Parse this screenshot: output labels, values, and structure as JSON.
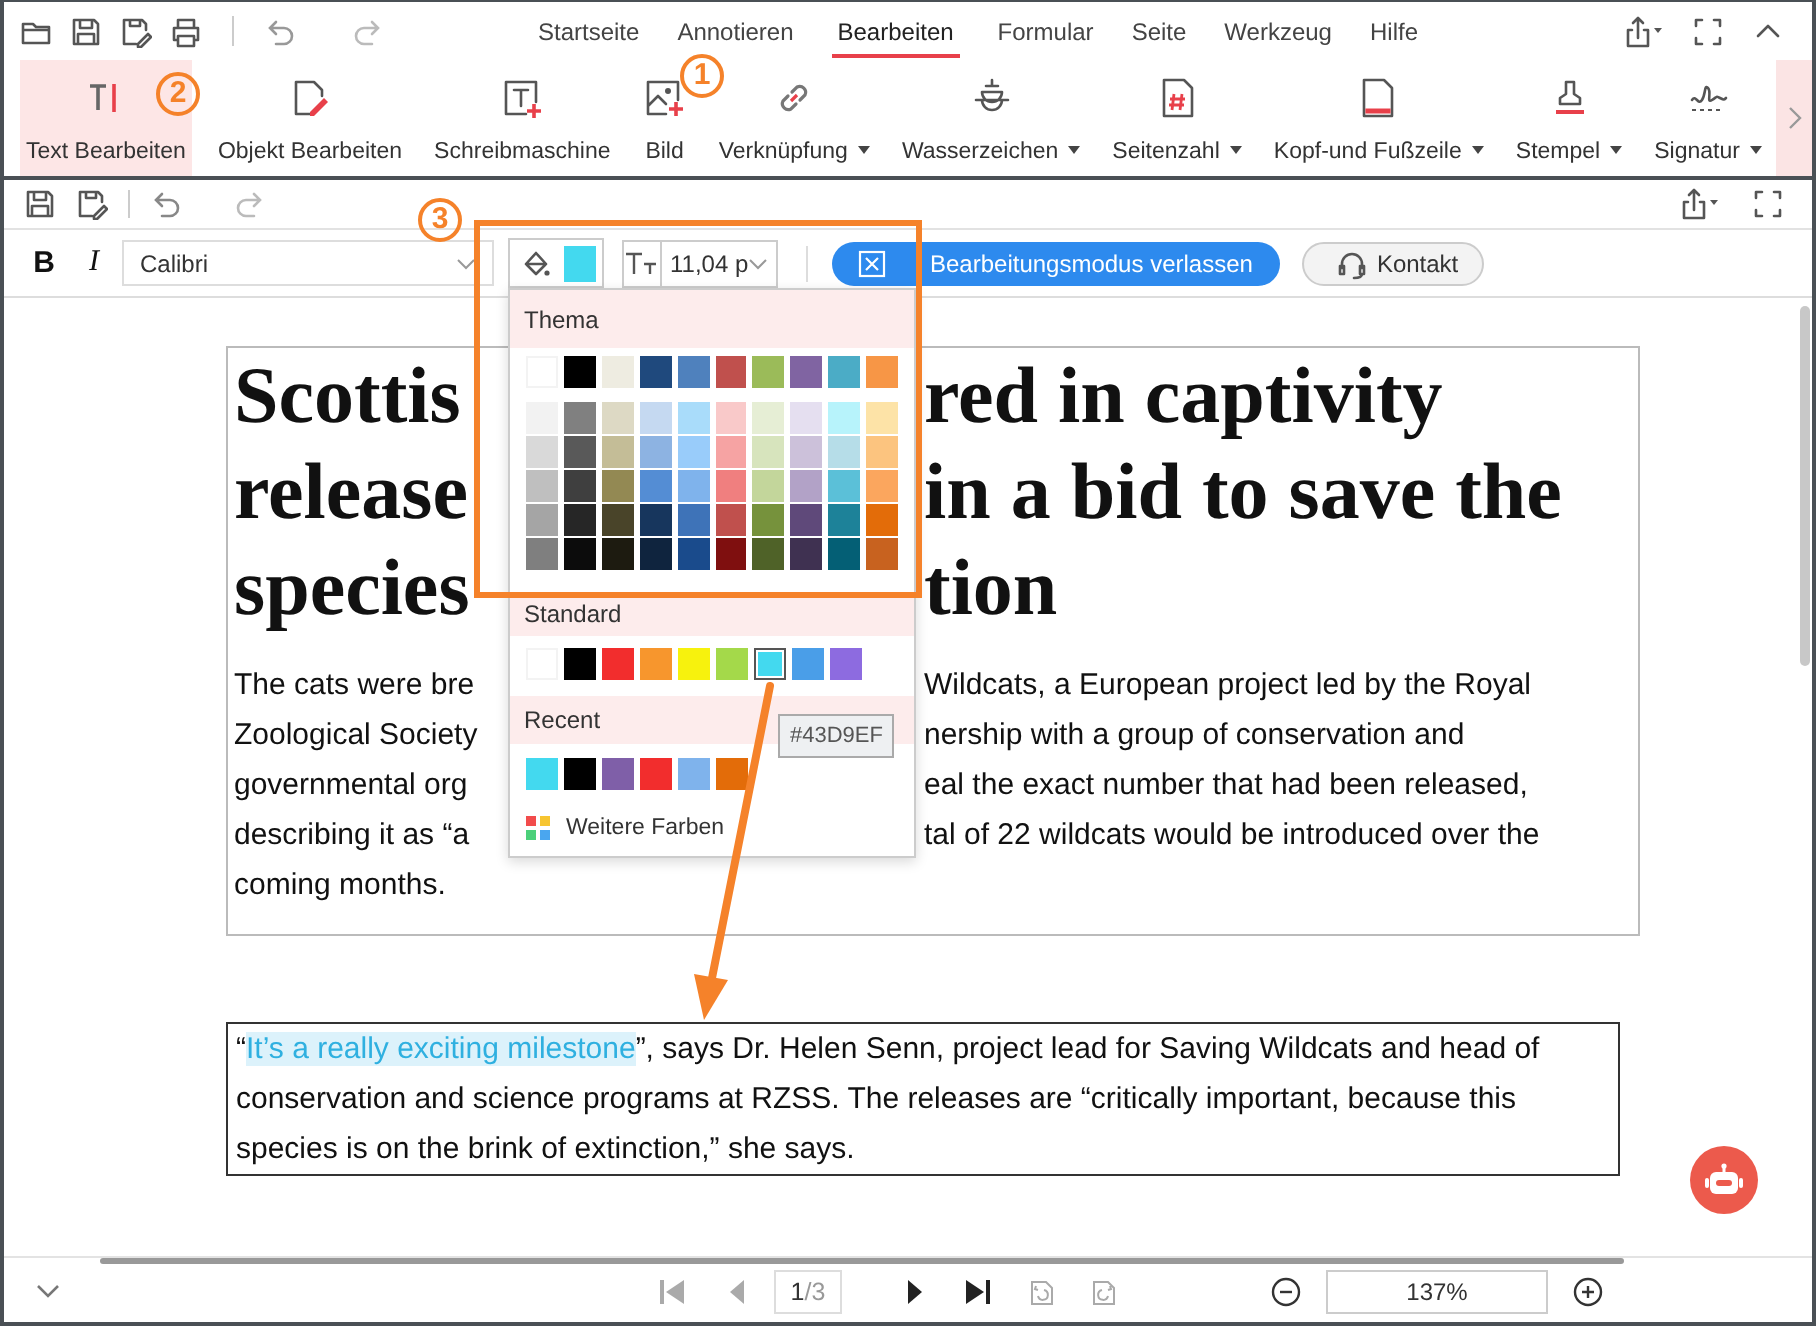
{
  "menu_tabs": [
    {
      "label": "Startseite",
      "selected": false
    },
    {
      "label": "Annotieren",
      "selected": false
    },
    {
      "label": "Bearbeiten",
      "selected": true
    },
    {
      "label": "Formular",
      "selected": false
    },
    {
      "label": "Seite",
      "selected": false
    },
    {
      "label": "Werkzeug",
      "selected": false
    },
    {
      "label": "Hilfe",
      "selected": false
    }
  ],
  "ribbon_tools": [
    {
      "label": "Text Bearbeiten",
      "selected": true,
      "dropdown": false
    },
    {
      "label": "Objekt Bearbeiten",
      "selected": false,
      "dropdown": false
    },
    {
      "label": "Schreibmaschine",
      "selected": false,
      "dropdown": false
    },
    {
      "label": "Bild",
      "selected": false,
      "dropdown": false
    },
    {
      "label": "Verknüpfung",
      "selected": false,
      "dropdown": true
    },
    {
      "label": "Wasserzeichen",
      "selected": false,
      "dropdown": true
    },
    {
      "label": "Seitenzahl",
      "selected": false,
      "dropdown": true
    },
    {
      "label": "Kopf-und Fußzeile",
      "selected": false,
      "dropdown": true
    },
    {
      "label": "Stempel",
      "selected": false,
      "dropdown": true
    },
    {
      "label": "Signatur",
      "selected": false,
      "dropdown": true
    }
  ],
  "format_bar": {
    "bold": "B",
    "italic": "I",
    "font": "Calibri",
    "color": "#43d9ef",
    "font_size": "11,04 p",
    "exit_button": "Bearbeitungsmodus verlassen",
    "contact_button": "Kontakt"
  },
  "color_popup": {
    "theme_label": "Thema",
    "theme_colors": [
      {
        "color": "#ffffff"
      },
      {
        "color": "#000000"
      },
      {
        "color": "#eeece1"
      },
      {
        "color": "#1f497d"
      },
      {
        "color": "#4f81bd"
      },
      {
        "color": "#c0504d"
      },
      {
        "color": "#9bbb59"
      },
      {
        "color": "#8064a2"
      },
      {
        "color": "#4bacc6"
      },
      {
        "color": "#f79646"
      }
    ],
    "theme_shades": [
      [
        {
          "color": "#f2f2f2"
        },
        {
          "color": "#808080"
        },
        {
          "color": "#ddd9c4"
        },
        {
          "color": "#c5d9f1"
        },
        {
          "color": "#a9dcfa"
        },
        {
          "color": "#f9c9c9"
        },
        {
          "color": "#e6eed5"
        },
        {
          "color": "#e5dff0"
        },
        {
          "color": "#b7f3fb"
        },
        {
          "color": "#fde3a7"
        }
      ],
      [
        {
          "color": "#d9d9d9"
        },
        {
          "color": "#595959"
        },
        {
          "color": "#c4bd97"
        },
        {
          "color": "#8db3e2"
        },
        {
          "color": "#99ccfa"
        },
        {
          "color": "#f6a3a3"
        },
        {
          "color": "#d7e4bd"
        },
        {
          "color": "#ccc1da"
        },
        {
          "color": "#b6dde8"
        },
        {
          "color": "#fcc47f"
        }
      ],
      [
        {
          "color": "#bfbfbf"
        },
        {
          "color": "#3f3f3f"
        },
        {
          "color": "#938953"
        },
        {
          "color": "#548dd4"
        },
        {
          "color": "#7fb3ec"
        },
        {
          "color": "#f07f7f"
        },
        {
          "color": "#c3d69b"
        },
        {
          "color": "#b2a2c7"
        },
        {
          "color": "#5bc0d8"
        },
        {
          "color": "#fba65e"
        }
      ],
      [
        {
          "color": "#a5a5a5"
        },
        {
          "color": "#262626"
        },
        {
          "color": "#494429"
        },
        {
          "color": "#17365d"
        },
        {
          "color": "#3e73b8"
        },
        {
          "color": "#c0504d"
        },
        {
          "color": "#76923c"
        },
        {
          "color": "#5f497a"
        },
        {
          "color": "#1d8299"
        },
        {
          "color": "#e36c09"
        }
      ],
      [
        {
          "color": "#7f7f7f"
        },
        {
          "color": "#0c0c0c"
        },
        {
          "color": "#1d1b10"
        },
        {
          "color": "#0f243e"
        },
        {
          "color": "#1a4b8c"
        },
        {
          "color": "#7f0f0f"
        },
        {
          "color": "#4f6228"
        },
        {
          "color": "#3f3151"
        },
        {
          "color": "#045f75"
        },
        {
          "color": "#c8621f"
        }
      ]
    ],
    "standard_label": "Standard",
    "standard_colors": [
      {
        "color": "#ffffff",
        "selected": false
      },
      {
        "color": "#000000",
        "selected": false
      },
      {
        "color": "#f22d2d",
        "selected": false
      },
      {
        "color": "#f7962d",
        "selected": false
      },
      {
        "color": "#f7f20d",
        "selected": false
      },
      {
        "color": "#a4d94a",
        "selected": false
      },
      {
        "color": "#43d9ef",
        "selected": true
      },
      {
        "color": "#4a9ee8",
        "selected": false
      },
      {
        "color": "#8d6be0",
        "selected": false
      }
    ],
    "recent_label": "Recent",
    "recent_colors": [
      {
        "color": "#43d9ef"
      },
      {
        "color": "#000000"
      },
      {
        "color": "#7f5fa8"
      },
      {
        "color": "#f22d2d"
      },
      {
        "color": "#7fb3ec"
      },
      {
        "color": "#e36c09"
      }
    ],
    "more_colors": "Weitere Farben",
    "tooltip": "#43D9EF"
  },
  "document": {
    "heading_lines": [
      {
        "left": "Scottis",
        "right": "red in captivity"
      },
      {
        "left": "release",
        "right": "in a bid to save the"
      },
      {
        "left": "species",
        "right": "tion"
      }
    ],
    "body_lines": [
      {
        "left": "The cats were bre",
        "right": "Wildcats, a European project led by the Royal"
      },
      {
        "left": "Zoological Society",
        "right": "nership with a group of conservation and"
      },
      {
        "left": "governmental org",
        "right": "eal the exact number that had been released,"
      },
      {
        "left": "describing it as “a",
        "right": "tal of 22 wildcats would be introduced over the"
      },
      {
        "left": "coming months."
      }
    ],
    "quote": {
      "before": "“",
      "highlighted": "It’s a really exciting milestone",
      "after": "”, says Dr. Helen Senn, project lead for Saving Wildcats and head of conservation and science programs at RZSS. The releases are “critically important, because this species is on the brink of extinction,” she says."
    }
  },
  "status_bar": {
    "nav_buttons": [
      {
        "disabled": true
      },
      {
        "disabled": true
      },
      {
        "disabled": false
      },
      {
        "disabled": false
      },
      {
        "disabled": true
      },
      {
        "disabled": true
      }
    ],
    "page": "1",
    "page_total": "/3",
    "zoom": "137%"
  },
  "annotations": [
    {
      "label": "1"
    },
    {
      "label": "2"
    },
    {
      "label": "3"
    }
  ]
}
